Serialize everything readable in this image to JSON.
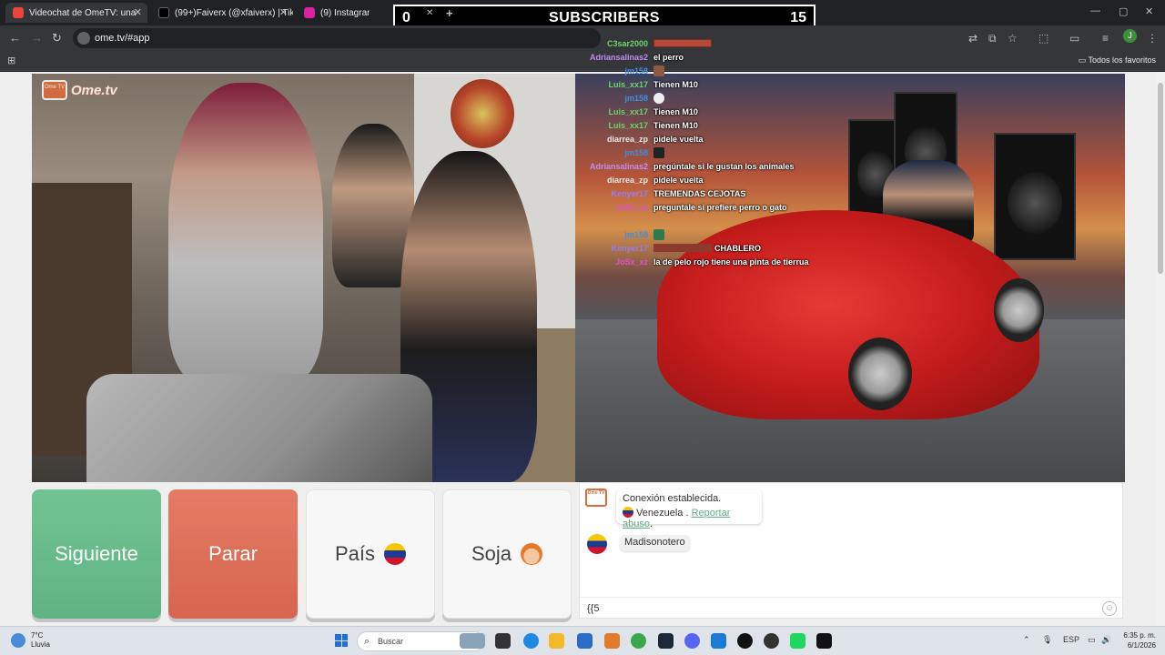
{
  "browser": {
    "tabs": [
      {
        "title": "Videochat de OmeTV: una",
        "active": true,
        "color": "#e8453c"
      },
      {
        "title": "(99+)Faiverx (@xfaiverx) | TikTok",
        "active": false,
        "color": "#000000"
      },
      {
        "title": "(9) Instagram",
        "active": false,
        "color": "#d6249f"
      }
    ],
    "url": "ome.tv/#app",
    "profile_initial": "J",
    "bookmarks_label": "Todos los favoritos"
  },
  "subscribers_overlay": {
    "left_count": "0",
    "title": "SUBSCRIBERS",
    "right_count": "15"
  },
  "video_left": {
    "logo_text": "Ome.tv",
    "logo_badge": "Ome TV"
  },
  "chat_overlay": [
    {
      "user": "C3sar2000",
      "msg": "",
      "color": "#6bd36b"
    },
    {
      "user": "Adriansalinas2",
      "msg": "el perro",
      "color": "#c08cf0"
    },
    {
      "user": "jm158",
      "msg": "",
      "color": "#3e8fe0"
    },
    {
      "user": "Luis_xx17",
      "msg": "Tienen M10",
      "color": "#6bd36b"
    },
    {
      "user": "jm158",
      "msg": "",
      "color": "#3e8fe0"
    },
    {
      "user": "Luis_xx17",
      "msg": "Tienen M10",
      "color": "#6bd36b"
    },
    {
      "user": "Luis_xx17",
      "msg": "Tienen M10",
      "color": "#6bd36b"
    },
    {
      "user": "diarrea_zp",
      "msg": "pidele vuelta",
      "color": "#e8e8e8"
    },
    {
      "user": "jm158",
      "msg": "",
      "color": "#3e8fe0"
    },
    {
      "user": "Adriansalinas2",
      "msg": "pregúntale si le gustan los animales",
      "color": "#c08cf0"
    },
    {
      "user": "diarrea_zp",
      "msg": "pidele vuelta",
      "color": "#e8e8e8"
    },
    {
      "user": "Kenyer17",
      "msg": "TREMENDAS CEJOTAS",
      "color": "#9a7cf0"
    },
    {
      "user": "JoSx_xz",
      "msg": "preguntale si prefiere perro o gato",
      "color": "#e04fd0"
    },
    {
      "user": "",
      "msg": "",
      "color": "#b8e86b"
    },
    {
      "user": "jm158",
      "msg": "",
      "color": "#3e8fe0"
    },
    {
      "user": "Kenyer17",
      "msg": "CHABLERO",
      "color": "#9a7cf0"
    },
    {
      "user": "JoSx_xz",
      "msg": "la de pelo rojo tiene una pinta de tierrua",
      "color": "#e04fd0"
    }
  ],
  "buttons": {
    "next": "Siguiente",
    "stop": "Parar",
    "country": "País",
    "gender": "Soja"
  },
  "chat_panel": {
    "connected": "Conexión establecida.",
    "country": "Venezuela",
    "separator": " . ",
    "report": "Reportar abuso",
    "period": ".",
    "user_message": "Madisonotero",
    "input_value": "{{5",
    "tv_badge": "Ome TV"
  },
  "taskbar": {
    "temperature": "7°C",
    "weather": "Lluvia",
    "search_placeholder": "Buscar",
    "lang": "ESP",
    "time": "6:35 p. m.",
    "date": "6/1/2026"
  }
}
